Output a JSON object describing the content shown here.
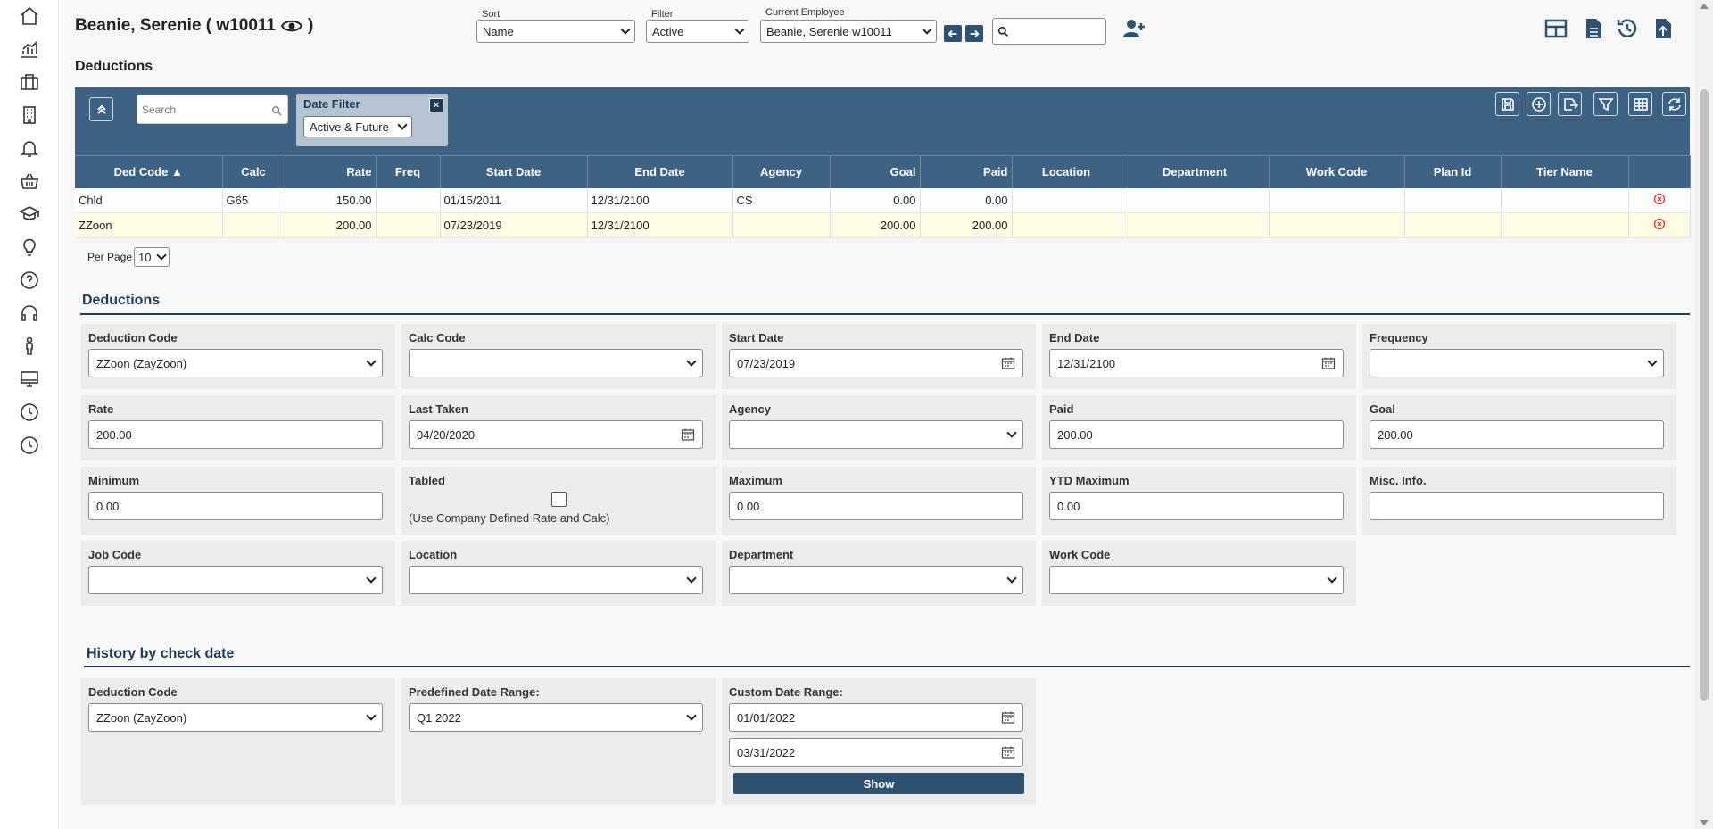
{
  "header": {
    "employee_title": "Beanie, Serenie ( w10011",
    "page_subtitle": "Deductions",
    "sort": {
      "label": "Sort",
      "value": "Name"
    },
    "filter": {
      "label": "Filter",
      "value": "Active"
    },
    "current_employee": {
      "label": "Current Employee",
      "value": "Beanie, Serenie w10011"
    }
  },
  "grid": {
    "search_placeholder": "Search",
    "date_filter": {
      "label": "Date Filter",
      "close": "×",
      "value": "Active & Future"
    },
    "columns": [
      "Ded Code ▲",
      "Calc",
      "Rate",
      "Freq",
      "Start Date",
      "End Date",
      "Agency",
      "Goal",
      "Paid",
      "Location",
      "Department",
      "Work Code",
      "Plan Id",
      "Tier Name",
      ""
    ],
    "rows": [
      [
        "Chld",
        "G65",
        "150.00",
        "",
        "01/15/2011",
        "12/31/2100",
        "CS",
        "0.00",
        "0.00",
        "",
        "",
        "",
        "",
        ""
      ],
      [
        "ZZoon",
        "",
        "200.00",
        "",
        "07/23/2019",
        "12/31/2100",
        "",
        "200.00",
        "200.00",
        "",
        "",
        "",
        "",
        ""
      ]
    ],
    "per_page_label": "Per Page",
    "per_page_value": "10"
  },
  "deductions_form": {
    "title": "Deductions",
    "deduction_code": {
      "label": "Deduction Code",
      "value": "ZZoon (ZayZoon)"
    },
    "calc_code": {
      "label": "Calc Code",
      "value": ""
    },
    "start_date": {
      "label": "Start Date",
      "value": "07/23/2019"
    },
    "end_date": {
      "label": "End Date",
      "value": "12/31/2100"
    },
    "frequency": {
      "label": "Frequency",
      "value": ""
    },
    "rate": {
      "label": "Rate",
      "value": "200.00"
    },
    "last_taken": {
      "label": "Last Taken",
      "value": "04/20/2020"
    },
    "agency": {
      "label": "Agency",
      "value": ""
    },
    "paid": {
      "label": "Paid",
      "value": "200.00"
    },
    "goal": {
      "label": "Goal",
      "value": "200.00"
    },
    "minimum": {
      "label": "Minimum",
      "value": "0.00"
    },
    "tabled": {
      "label": "Tabled",
      "note": "(Use Company Defined Rate and Calc)"
    },
    "maximum": {
      "label": "Maximum",
      "value": "0.00"
    },
    "ytd_maximum": {
      "label": "YTD Maximum",
      "value": "0.00"
    },
    "misc_info": {
      "label": "Misc. Info.",
      "value": ""
    },
    "job_code": {
      "label": "Job Code",
      "value": ""
    },
    "location": {
      "label": "Location",
      "value": ""
    },
    "department": {
      "label": "Department",
      "value": ""
    },
    "work_code": {
      "label": "Work Code",
      "value": ""
    }
  },
  "history": {
    "title": "History by check date",
    "deduction_code": {
      "label": "Deduction Code",
      "value": "ZZoon (ZayZoon)"
    },
    "predefined_range": {
      "label": "Predefined Date Range:",
      "value": "Q1 2022"
    },
    "custom_range": {
      "label": "Custom Date Range:",
      "from": "01/01/2022",
      "to": "03/31/2022"
    },
    "show_label": "Show"
  },
  "colors": {
    "header_blue": "#3d6283",
    "dark_blue": "#2f5270",
    "selected_row": "#fdfbe3"
  }
}
